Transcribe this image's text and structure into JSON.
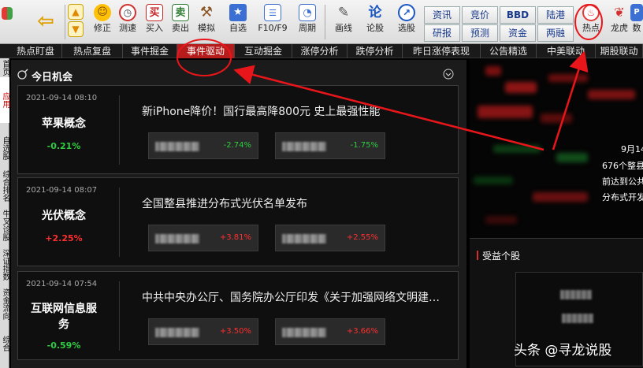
{
  "toolbar": {
    "buttons": [
      {
        "label": "",
        "icon": "home-icon"
      },
      {
        "label": "",
        "icon": "back-arrow-icon"
      },
      {
        "label": "修正",
        "icon": "smile-icon"
      },
      {
        "label": "测速",
        "icon": "clock-icon"
      },
      {
        "label": "买入",
        "icon": "buy-icon",
        "glyph": "买"
      },
      {
        "label": "卖出",
        "icon": "sell-icon",
        "glyph": "卖"
      },
      {
        "label": "模拟",
        "icon": "gavel-icon"
      },
      {
        "label": "自选",
        "icon": "star-icon"
      },
      {
        "label": "F10/F9",
        "icon": "document-icon"
      },
      {
        "label": "周期",
        "icon": "period-icon"
      },
      {
        "label": "画线",
        "icon": "pencil-icon"
      },
      {
        "label": "论股",
        "icon": "discuss-icon",
        "glyph": "论"
      },
      {
        "label": "选股",
        "icon": "chart-select-icon"
      },
      {
        "label": "热点",
        "icon": "hot-icon"
      },
      {
        "label": "龙虎",
        "icon": "dragon-icon"
      },
      {
        "label": "数",
        "icon": "data-icon"
      }
    ],
    "small_buttons": [
      {
        "label": "资讯"
      },
      {
        "label": "竞价"
      },
      {
        "label": "BBD"
      },
      {
        "label": "陆港"
      },
      {
        "label": "研报"
      },
      {
        "label": "预测"
      },
      {
        "label": "资金"
      },
      {
        "label": "两融"
      }
    ]
  },
  "tabs": [
    {
      "label": "热点盯盘"
    },
    {
      "label": "热点复盘"
    },
    {
      "label": "事件掘金"
    },
    {
      "label": "事件驱动",
      "active": true
    },
    {
      "label": "互动掘金"
    },
    {
      "label": "涨停分析"
    },
    {
      "label": "跌停分析"
    },
    {
      "label": "昨日涨停表现"
    },
    {
      "label": "公告精选"
    },
    {
      "label": "中美联动"
    },
    {
      "label": "期股联动"
    }
  ],
  "vtabs": [
    {
      "label": "首页"
    },
    {
      "label": "应用",
      "active": true
    },
    {
      "label": "自选股"
    },
    {
      "label": "综合排名"
    },
    {
      "label": "牛叉诊股"
    },
    {
      "label": "深证指数"
    },
    {
      "label": "资金流向"
    },
    {
      "label": "综合"
    }
  ],
  "panel": {
    "title": "今日机会",
    "cards": [
      {
        "time": "2021-09-14 08:10",
        "concept": "苹果概念",
        "change": "-0.21%",
        "direction": "down",
        "headline": "新iPhone降价！国行最高降800元 史上最强性能",
        "stocks": [
          {
            "name": "■■■■",
            "pct": "-2.74%",
            "direction": "down"
          },
          {
            "name": "■■■■",
            "pct": "-1.75%",
            "direction": "down"
          }
        ]
      },
      {
        "time": "2021-09-14 08:07",
        "concept": "光伏概念",
        "change": "+2.25%",
        "direction": "up",
        "headline": "全国整县推进分布式光伏名单发布",
        "stocks": [
          {
            "name": "■■■■",
            "pct": "+3.81%",
            "direction": "up"
          },
          {
            "name": "■■■■",
            "pct": "+2.55%",
            "direction": "up"
          }
        ]
      },
      {
        "time": "2021-09-14 07:54",
        "concept": "互联网信息服务",
        "change": "-0.59%",
        "direction": "down",
        "headline": "中共中央办公厅、国务院办公厅印发《关于加强网络文明建…",
        "stocks": [
          {
            "name": "■■■■",
            "pct": "+3.50%",
            "direction": "up"
          },
          {
            "name": "■■■■",
            "pct": "+3.66%",
            "direction": "up"
          }
        ]
      }
    ]
  },
  "right": {
    "lines": [
      "9月14",
      "676个整县",
      "前达到公共",
      "分布式开发"
    ],
    "benefit_title": "受益个股"
  },
  "watermark": "头条 @寻龙说股",
  "colors": {
    "up": "#ff2e2e",
    "down": "#2ecc40",
    "active_tab": "#b71c1c",
    "annotation": "#e8161b"
  }
}
